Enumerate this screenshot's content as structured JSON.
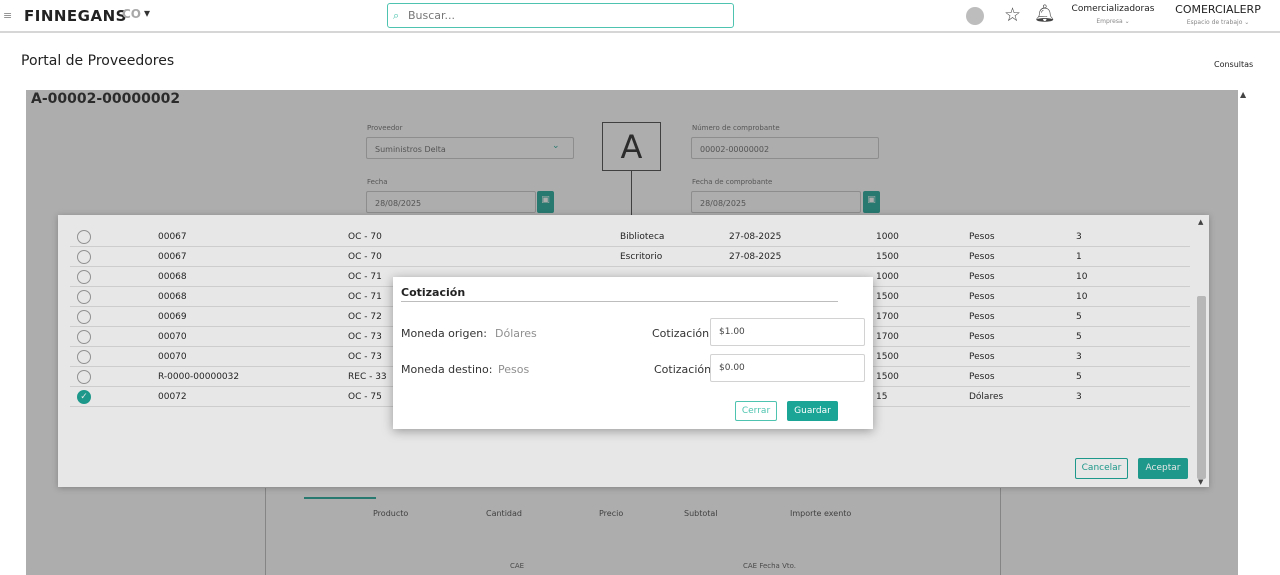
{
  "topbar": {
    "menu_icon": "hamburger-icon",
    "logo": "FINNEGANS",
    "logo_mark": "CO",
    "search_placeholder": "Buscar...",
    "company": "Comercializadoras",
    "company_caption": "Empresa ⌄",
    "workspace": "COMERCIALERP",
    "workspace_caption": "Espacio de trabajo ⌄"
  },
  "page": {
    "title": "Portal de Proveedores",
    "consultas": "Consultas"
  },
  "doc": {
    "number": "A-00002-00000002",
    "proveedor_label": "Proveedor",
    "proveedor_value": "Suministros Delta",
    "letter": "A",
    "numero_label": "Número de comprobante",
    "numero_value": "00002-00000002",
    "fecha_label": "Fecha",
    "fecha_value": "28/08/2025",
    "fecha_comp_label": "Fecha de comprobante",
    "fecha_comp_value": "28/08/2025",
    "columns": [
      "Producto",
      "Cantidad",
      "Precio",
      "Subtotal",
      "Importe exento"
    ],
    "footer_cae": "CAE",
    "footer_cae_fecha": "CAE Fecha Vto."
  },
  "table": {
    "rows": [
      {
        "num": "00067",
        "oc": "OC - 70",
        "dest": "Biblioteca",
        "date": "27-08-2025",
        "amount": "1000",
        "currency": "Pesos",
        "qty": "3",
        "checked": false
      },
      {
        "num": "00067",
        "oc": "OC - 70",
        "dest": "Escritorio",
        "date": "27-08-2025",
        "amount": "1500",
        "currency": "Pesos",
        "qty": "1",
        "checked": false
      },
      {
        "num": "00068",
        "oc": "OC - 71",
        "dest": "",
        "date": "",
        "amount": "1000",
        "currency": "Pesos",
        "qty": "10",
        "checked": false
      },
      {
        "num": "00068",
        "oc": "OC - 71",
        "dest": "",
        "date": "",
        "amount": "1500",
        "currency": "Pesos",
        "qty": "10",
        "checked": false
      },
      {
        "num": "00069",
        "oc": "OC - 72",
        "dest": "",
        "date": "",
        "amount": "1700",
        "currency": "Pesos",
        "qty": "5",
        "checked": false
      },
      {
        "num": "00070",
        "oc": "OC - 73",
        "dest": "",
        "date": "",
        "amount": "1700",
        "currency": "Pesos",
        "qty": "5",
        "checked": false
      },
      {
        "num": "00070",
        "oc": "OC - 73",
        "dest": "",
        "date": "",
        "amount": "1500",
        "currency": "Pesos",
        "qty": "3",
        "checked": false
      },
      {
        "num": "R-0000-00000032",
        "oc": "REC - 33",
        "dest": "",
        "date": "",
        "amount": "1500",
        "currency": "Pesos",
        "qty": "5",
        "checked": false
      },
      {
        "num": "00072",
        "oc": "OC - 75",
        "dest": "",
        "date": "",
        "amount": "15",
        "currency": "Dólares",
        "qty": "3",
        "checked": true
      }
    ],
    "cancel_label": "Cancelar",
    "accept_label": "Aceptar"
  },
  "modal": {
    "title": "Cotización",
    "origen_label": "Moneda origen:",
    "origen_value": "Dólares",
    "destino_label": "Moneda destino:",
    "destino_value": "Pesos",
    "cotizacion_label": "Cotización",
    "cotizacion_origen": "$1.00",
    "cotizacion_destino": "$0.00",
    "close_label": "Cerrar",
    "save_label": "Guardar"
  },
  "colors": {
    "accent": "#1aa596",
    "accent_light": "#4ec4b0"
  }
}
